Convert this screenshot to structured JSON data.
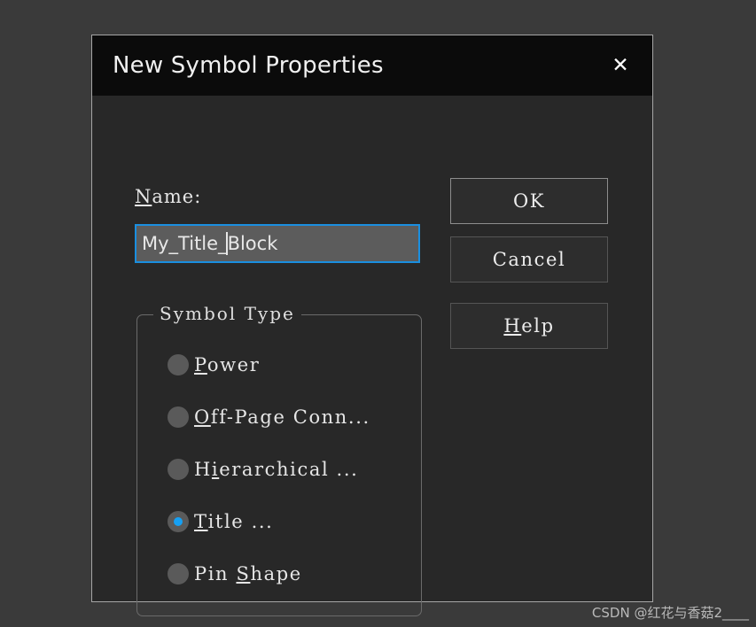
{
  "dialog": {
    "title": "New Symbol Properties",
    "close_icon": "close-icon",
    "close_glyph": "✕"
  },
  "form": {
    "name_label_accel": "N",
    "name_label_rest": "ame:",
    "name_value_before_caret": "My_Title_",
    "name_value_after_caret": "Block",
    "name_value": "My_Title_Block"
  },
  "symbol_type": {
    "legend": "Symbol Type",
    "options": [
      {
        "accel": "P",
        "pre": "",
        "rest": "ower",
        "selected": false
      },
      {
        "accel": "O",
        "pre": "",
        "rest": "ff-Page Conn...",
        "selected": false
      },
      {
        "accel": "i",
        "pre": "H",
        "rest": "erarchical ...",
        "selected": false
      },
      {
        "accel": "T",
        "pre": "",
        "rest": "itle ...",
        "selected": true
      },
      {
        "accel": "S",
        "pre": "Pin ",
        "rest": "hape",
        "selected": false
      }
    ]
  },
  "buttons": {
    "ok": {
      "pre": "",
      "accel": "",
      "rest": "OK"
    },
    "cancel": {
      "pre": "",
      "accel": "",
      "rest": "Cancel"
    },
    "help": {
      "pre": "",
      "accel": "H",
      "rest": "elp"
    }
  },
  "watermark": "CSDN @红花与香菇2____",
  "colors": {
    "page_background": "#3a3a3a",
    "dialog_background": "#282828",
    "titlebar_background": "#0b0b0b",
    "dialog_border": "#a6a6a6",
    "input_border_focus": "#1a8fe0",
    "input_fill": "#5c5c5c",
    "radio_fill": "#5a5a5a",
    "radio_dot": "#16a0f3",
    "text": "#e6e6e6"
  }
}
